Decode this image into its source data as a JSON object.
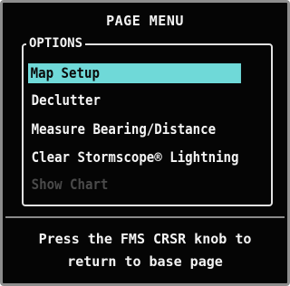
{
  "menu": {
    "title": "PAGE MENU",
    "options_label": "OPTIONS",
    "items": [
      {
        "label": "Map Setup",
        "state": "selected"
      },
      {
        "label": "Declutter",
        "state": "enabled"
      },
      {
        "label": "Measure Bearing/Distance",
        "state": "enabled"
      },
      {
        "label": "Clear Stormscope® Lightning",
        "state": "enabled"
      },
      {
        "label": "Show Chart",
        "state": "disabled"
      }
    ]
  },
  "hint": {
    "line1": "Press the FMS CRSR knob to",
    "line2": "return to base page"
  },
  "colors": {
    "background": "#050505",
    "frame": "#8d8d8d",
    "text": "#f4f4f4",
    "selection": "#6fd9d8",
    "disabled_text": "#4a4a4a"
  }
}
